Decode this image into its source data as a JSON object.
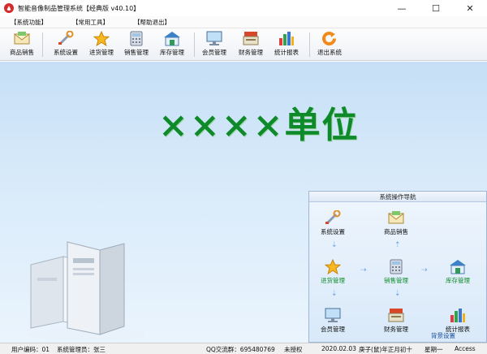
{
  "window": {
    "title": "智能音像制品管理系统【经典版 v40.10】",
    "minimize": "—",
    "maximize": "☐",
    "close": "✕"
  },
  "menu": [
    "【系统功能】",
    "【常用工具】",
    "【帮助退出】"
  ],
  "toolbar": {
    "items": [
      "商品销售",
      "系统设置",
      "进货管理",
      "销售管理",
      "库存管理",
      "会员管理",
      "财务管理",
      "统计报表",
      "退出系统"
    ]
  },
  "banner": "××××单位",
  "nav": {
    "title": "系统操作导航",
    "system_settings": "系统设置",
    "product_sales": "商品销售",
    "purchase": "进货管理",
    "sales": "销售管理",
    "inventory": "库存管理",
    "members": "会员管理",
    "finance": "财务管理",
    "reports": "统计报表",
    "background": "背景设置"
  },
  "status": {
    "user_code": "用户编码：01",
    "admin": "系统管理员：张三",
    "qq": "QQ交流群：695480769",
    "license": "未授权",
    "date": "2020.02.03",
    "lunar": "庚子(鼠)年正月初十",
    "weekday": "星期一",
    "db": "Access"
  },
  "colors": {
    "banner_green": "#0f8a2a",
    "main_bg": "#d9ebfa",
    "nav_green_label": "#0b8b28"
  }
}
